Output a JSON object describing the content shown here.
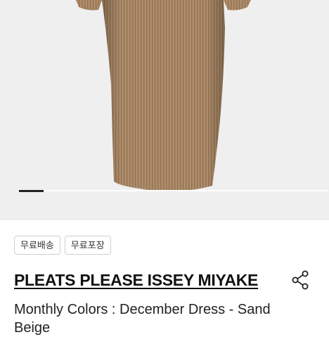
{
  "product": {
    "image_alt": "sand beige pleated dress",
    "gallery_pages": 2,
    "gallery_active_index": 1,
    "tags": [
      "무료배송",
      "무료포장"
    ],
    "brand": "PLEATS PLEASE ISSEY MIYAKE",
    "title": "Monthly Colors : December Dress - Sand Beige"
  },
  "icons": {
    "share": "share-icon"
  },
  "colors": {
    "dress": "#a88664",
    "background": "#efefef",
    "text": "#111111"
  }
}
